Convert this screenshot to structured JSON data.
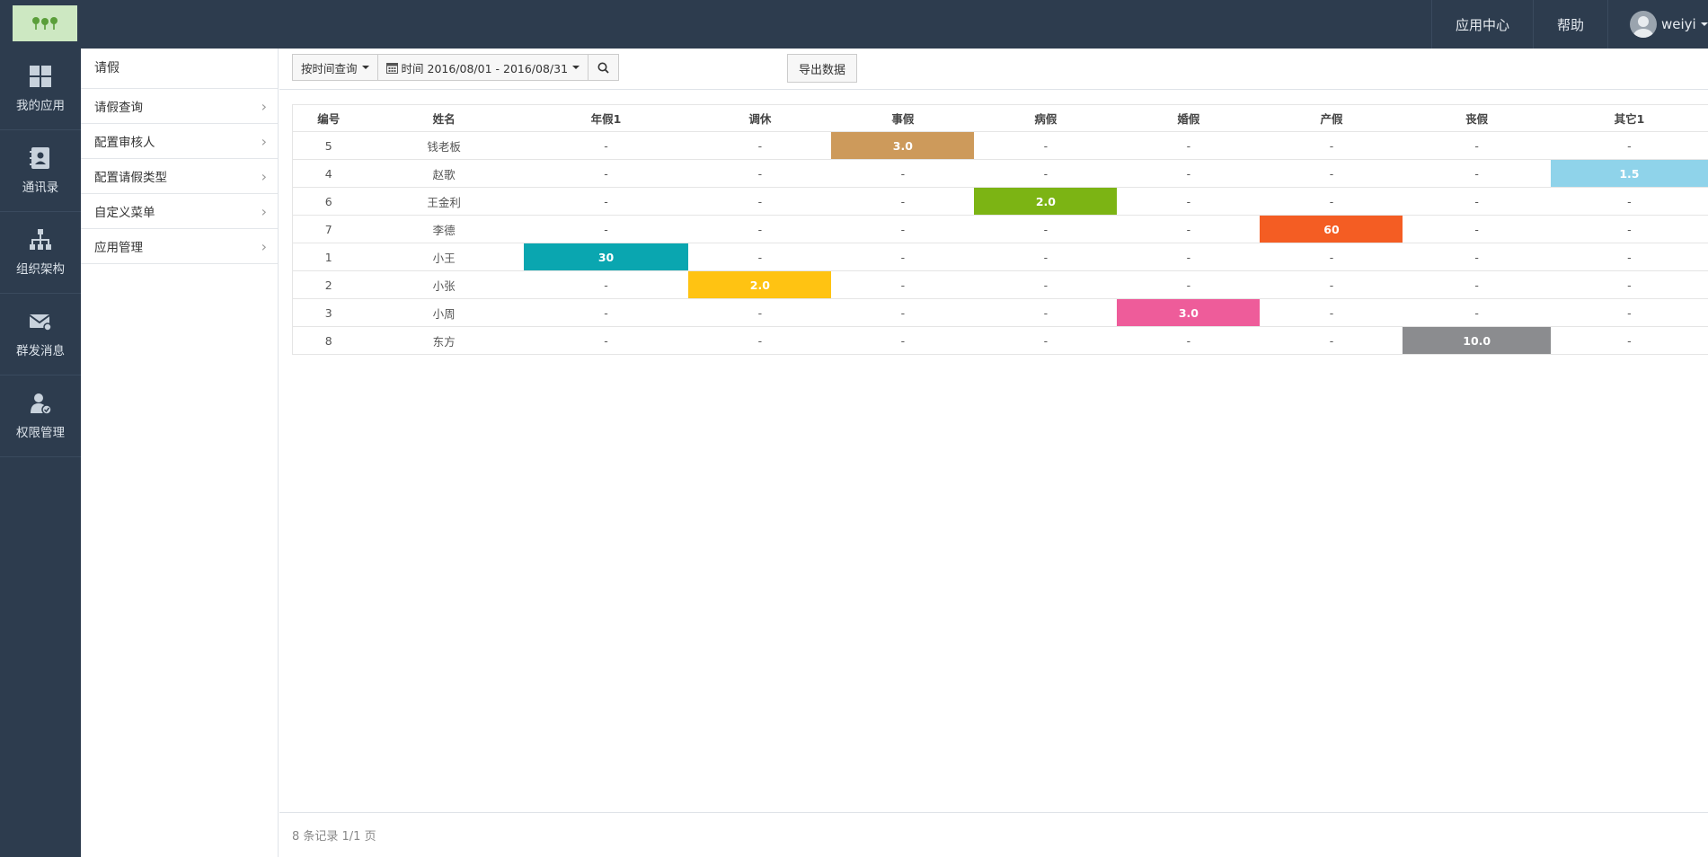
{
  "topbar": {
    "nav": [
      "应用中心",
      "帮助"
    ],
    "user": "weiyi"
  },
  "iconbar": [
    {
      "label": "我的应用",
      "icon": "grid-icon"
    },
    {
      "label": "通讯录",
      "icon": "contacts-icon"
    },
    {
      "label": "组织架构",
      "icon": "org-chart-icon"
    },
    {
      "label": "群发消息",
      "icon": "mail-icon"
    },
    {
      "label": "权限管理",
      "icon": "user-permission-icon"
    }
  ],
  "submenu": {
    "title": "请假",
    "items": [
      "请假查询",
      "配置审核人",
      "配置请假类型",
      "自定义菜单",
      "应用管理"
    ]
  },
  "toolbar": {
    "query_mode": "按时间查询",
    "date_range": "时间 2016/08/01 - 2016/08/31",
    "export_label": "导出数据"
  },
  "table": {
    "columns": [
      "编号",
      "姓名",
      "年假1",
      "调休",
      "事假",
      "病假",
      "婚假",
      "产假",
      "丧假",
      "其它1"
    ],
    "rows": [
      [
        "5",
        "钱老板",
        "-",
        "-",
        "3.0",
        "-",
        "-",
        "-",
        "-",
        "-"
      ],
      [
        "4",
        "赵歌",
        "-",
        "-",
        "-",
        "-",
        "-",
        "-",
        "-",
        "1.5"
      ],
      [
        "6",
        "王金利",
        "-",
        "-",
        "-",
        "2.0",
        "-",
        "-",
        "-",
        "-"
      ],
      [
        "7",
        "李德",
        "-",
        "-",
        "-",
        "-",
        "-",
        "60",
        "-",
        "-"
      ],
      [
        "1",
        "小王",
        "30",
        "-",
        "-",
        "-",
        "-",
        "-",
        "-",
        "-"
      ],
      [
        "2",
        "小张",
        "-",
        "2.0",
        "-",
        "-",
        "-",
        "-",
        "-",
        "-"
      ],
      [
        "3",
        "小周",
        "-",
        "-",
        "-",
        "-",
        "3.0",
        "-",
        "-",
        "-"
      ],
      [
        "8",
        "东方",
        "-",
        "-",
        "-",
        "-",
        "-",
        "-",
        "10.0",
        "-"
      ]
    ],
    "column_colors": {
      "年假1": "#0aa6b0",
      "调休": "#ffc312",
      "事假": "#cd9a5b",
      "病假": "#7cb414",
      "婚假": "#ee5c9a",
      "产假": "#f45d23",
      "丧假": "#8b8c8f",
      "其它1": "#8fd3ea"
    }
  },
  "footer": {
    "summary": "8 条记录 1/1 页"
  }
}
